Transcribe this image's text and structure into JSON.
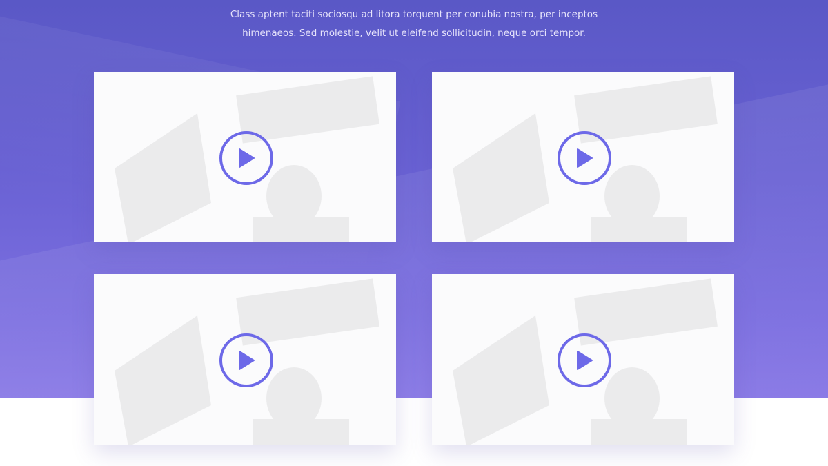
{
  "intro": {
    "line1": "Class aptent taciti sociosqu ad litora torquent per conubia nostra, per inceptos",
    "line2": "himenaeos. Sed molestie, velit ut eleifend sollicitudin, neque orci tempor."
  },
  "videos": [
    {
      "icon": "play-icon"
    },
    {
      "icon": "play-icon"
    },
    {
      "icon": "play-icon"
    },
    {
      "icon": "play-icon"
    }
  ],
  "colors": {
    "accent": "#6d69e8",
    "hero_top": "#5a58c6",
    "hero_bottom": "#8a7ae6",
    "card": "#fbfbfc",
    "intro_text": "#e6e3fb"
  }
}
